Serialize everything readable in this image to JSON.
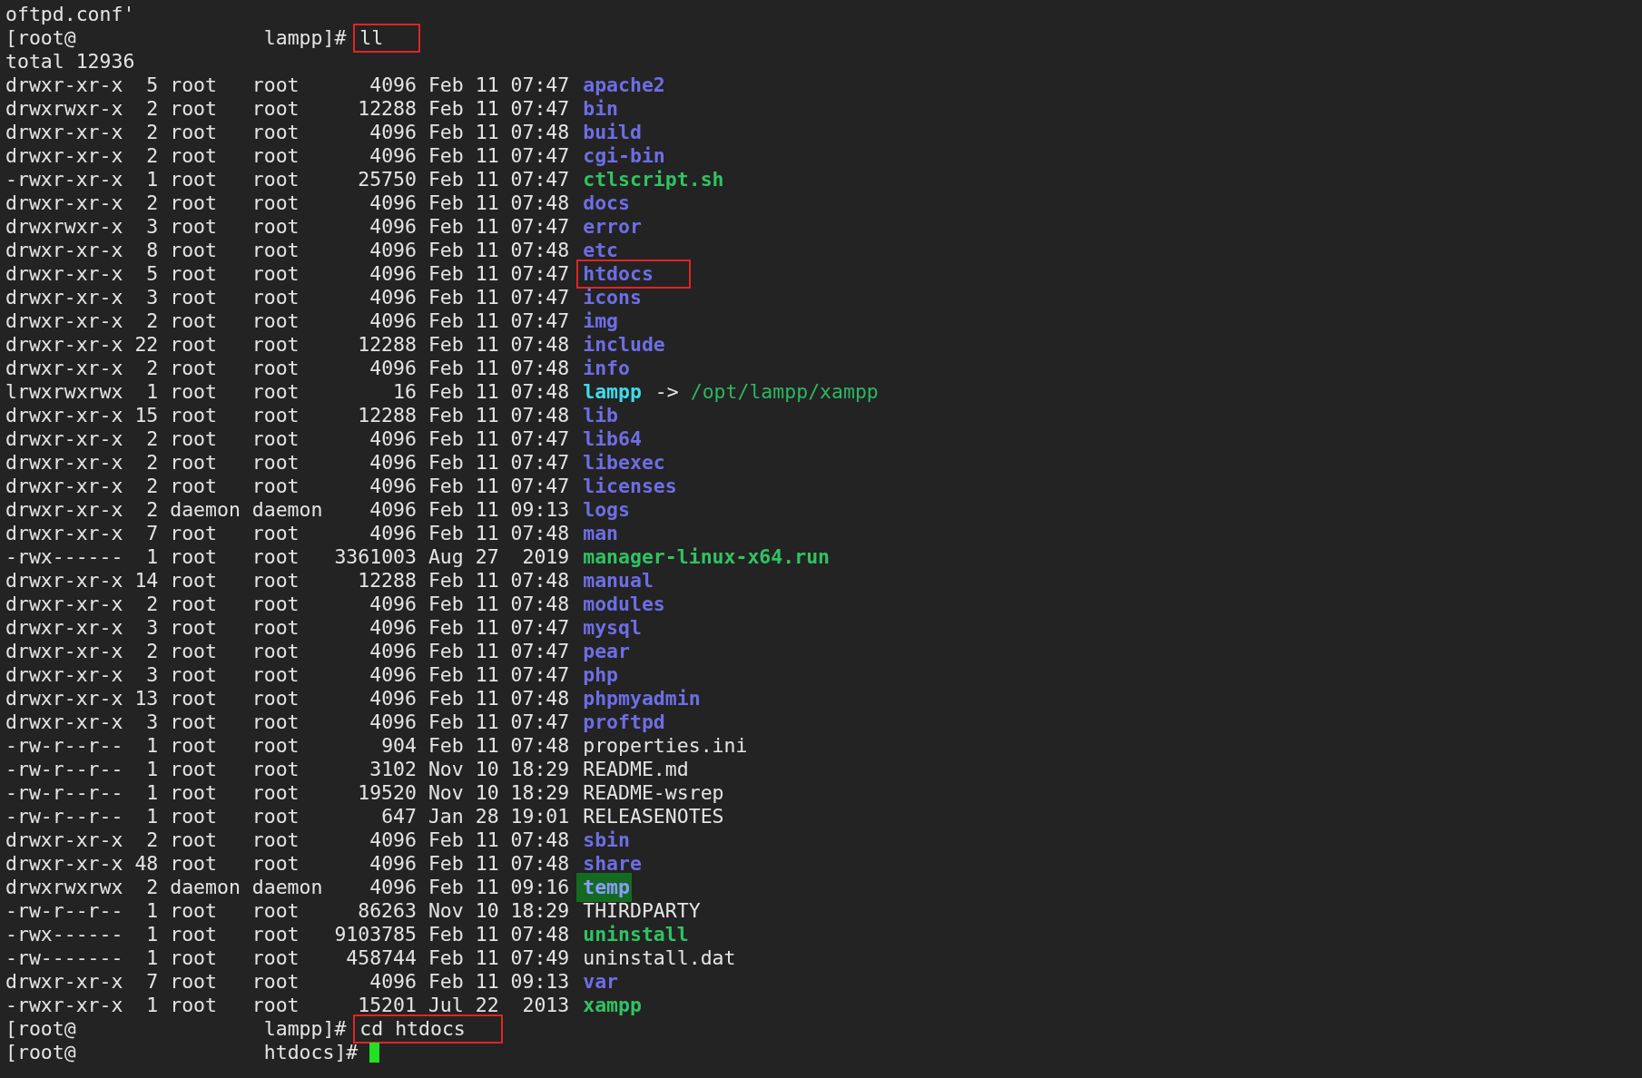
{
  "lines": [
    {
      "kind": "text",
      "text": "oftpd.conf'"
    },
    {
      "kind": "prompt",
      "user": "[root@",
      "dir": "lampp]#",
      "command": "ll",
      "boxed": true,
      "cursor": false
    },
    {
      "kind": "text",
      "text": "total 12936"
    },
    {
      "kind": "dir",
      "mode": "drwxr-xr-x",
      "links": "5",
      "owner": "root",
      "group": "root",
      "bytes": "4096",
      "date": "Feb 11 07:47",
      "name": "apache2",
      "boxed": false
    },
    {
      "kind": "dir",
      "mode": "drwxrwxr-x",
      "links": "2",
      "owner": "root",
      "group": "root",
      "bytes": "12288",
      "date": "Feb 11 07:47",
      "name": "bin",
      "boxed": false
    },
    {
      "kind": "dir",
      "mode": "drwxr-xr-x",
      "links": "2",
      "owner": "root",
      "group": "root",
      "bytes": "4096",
      "date": "Feb 11 07:48",
      "name": "build",
      "boxed": false
    },
    {
      "kind": "dir",
      "mode": "drwxr-xr-x",
      "links": "2",
      "owner": "root",
      "group": "root",
      "bytes": "4096",
      "date": "Feb 11 07:47",
      "name": "cgi-bin",
      "boxed": false
    },
    {
      "kind": "exec",
      "mode": "-rwxr-xr-x",
      "links": "1",
      "owner": "root",
      "group": "root",
      "bytes": "25750",
      "date": "Feb 11 07:47",
      "name": "ctlscript.sh",
      "boxed": false
    },
    {
      "kind": "dir",
      "mode": "drwxr-xr-x",
      "links": "2",
      "owner": "root",
      "group": "root",
      "bytes": "4096",
      "date": "Feb 11 07:48",
      "name": "docs",
      "boxed": false
    },
    {
      "kind": "dir",
      "mode": "drwxrwxr-x",
      "links": "3",
      "owner": "root",
      "group": "root",
      "bytes": "4096",
      "date": "Feb 11 07:47",
      "name": "error",
      "boxed": false
    },
    {
      "kind": "dir",
      "mode": "drwxr-xr-x",
      "links": "8",
      "owner": "root",
      "group": "root",
      "bytes": "4096",
      "date": "Feb 11 07:48",
      "name": "etc",
      "boxed": false
    },
    {
      "kind": "dir",
      "mode": "drwxr-xr-x",
      "links": "5",
      "owner": "root",
      "group": "root",
      "bytes": "4096",
      "date": "Feb 11 07:47",
      "name": "htdocs",
      "boxed": true
    },
    {
      "kind": "dir",
      "mode": "drwxr-xr-x",
      "links": "3",
      "owner": "root",
      "group": "root",
      "bytes": "4096",
      "date": "Feb 11 07:47",
      "name": "icons",
      "boxed": false
    },
    {
      "kind": "dir",
      "mode": "drwxr-xr-x",
      "links": "2",
      "owner": "root",
      "group": "root",
      "bytes": "4096",
      "date": "Feb 11 07:47",
      "name": "img",
      "boxed": false
    },
    {
      "kind": "dir",
      "mode": "drwxr-xr-x",
      "links": "22",
      "owner": "root",
      "group": "root",
      "bytes": "12288",
      "date": "Feb 11 07:48",
      "name": "include",
      "boxed": false
    },
    {
      "kind": "dir",
      "mode": "drwxr-xr-x",
      "links": "2",
      "owner": "root",
      "group": "root",
      "bytes": "4096",
      "date": "Feb 11 07:48",
      "name": "info",
      "boxed": false
    },
    {
      "kind": "link",
      "mode": "lrwxrwxrwx",
      "links": "1",
      "owner": "root",
      "group": "root",
      "bytes": "16",
      "date": "Feb 11 07:48",
      "name": "lampp",
      "arrow": "->",
      "target": "/opt/lampp/xampp",
      "boxed": false
    },
    {
      "kind": "dir",
      "mode": "drwxr-xr-x",
      "links": "15",
      "owner": "root",
      "group": "root",
      "bytes": "12288",
      "date": "Feb 11 07:48",
      "name": "lib",
      "boxed": false
    },
    {
      "kind": "dir",
      "mode": "drwxr-xr-x",
      "links": "2",
      "owner": "root",
      "group": "root",
      "bytes": "4096",
      "date": "Feb 11 07:47",
      "name": "lib64",
      "boxed": false
    },
    {
      "kind": "dir",
      "mode": "drwxr-xr-x",
      "links": "2",
      "owner": "root",
      "group": "root",
      "bytes": "4096",
      "date": "Feb 11 07:47",
      "name": "libexec",
      "boxed": false
    },
    {
      "kind": "dir",
      "mode": "drwxr-xr-x",
      "links": "2",
      "owner": "root",
      "group": "root",
      "bytes": "4096",
      "date": "Feb 11 07:47",
      "name": "licenses",
      "boxed": false
    },
    {
      "kind": "dir",
      "mode": "drwxr-xr-x",
      "links": "2",
      "owner": "daemon",
      "group": "daemon",
      "bytes": "4096",
      "date": "Feb 11 09:13",
      "name": "logs",
      "boxed": false
    },
    {
      "kind": "dir",
      "mode": "drwxr-xr-x",
      "links": "7",
      "owner": "root",
      "group": "root",
      "bytes": "4096",
      "date": "Feb 11 07:48",
      "name": "man",
      "boxed": false
    },
    {
      "kind": "exec",
      "mode": "-rwx------",
      "links": "1",
      "owner": "root",
      "group": "root",
      "bytes": "3361003",
      "date": "Aug 27  2019",
      "name": "manager-linux-x64.run",
      "boxed": false
    },
    {
      "kind": "dir",
      "mode": "drwxr-xr-x",
      "links": "14",
      "owner": "root",
      "group": "root",
      "bytes": "12288",
      "date": "Feb 11 07:48",
      "name": "manual",
      "boxed": false
    },
    {
      "kind": "dir",
      "mode": "drwxr-xr-x",
      "links": "2",
      "owner": "root",
      "group": "root",
      "bytes": "4096",
      "date": "Feb 11 07:48",
      "name": "modules",
      "boxed": false
    },
    {
      "kind": "dir",
      "mode": "drwxr-xr-x",
      "links": "3",
      "owner": "root",
      "group": "root",
      "bytes": "4096",
      "date": "Feb 11 07:47",
      "name": "mysql",
      "boxed": false
    },
    {
      "kind": "dir",
      "mode": "drwxr-xr-x",
      "links": "2",
      "owner": "root",
      "group": "root",
      "bytes": "4096",
      "date": "Feb 11 07:47",
      "name": "pear",
      "boxed": false
    },
    {
      "kind": "dir",
      "mode": "drwxr-xr-x",
      "links": "3",
      "owner": "root",
      "group": "root",
      "bytes": "4096",
      "date": "Feb 11 07:47",
      "name": "php",
      "boxed": false
    },
    {
      "kind": "dir",
      "mode": "drwxr-xr-x",
      "links": "13",
      "owner": "root",
      "group": "root",
      "bytes": "4096",
      "date": "Feb 11 07:48",
      "name": "phpmyadmin",
      "boxed": false
    },
    {
      "kind": "dir",
      "mode": "drwxr-xr-x",
      "links": "3",
      "owner": "root",
      "group": "root",
      "bytes": "4096",
      "date": "Feb 11 07:47",
      "name": "proftpd",
      "boxed": false
    },
    {
      "kind": "file",
      "mode": "-rw-r--r--",
      "links": "1",
      "owner": "root",
      "group": "root",
      "bytes": "904",
      "date": "Feb 11 07:48",
      "name": "properties.ini",
      "boxed": false
    },
    {
      "kind": "file",
      "mode": "-rw-r--r--",
      "links": "1",
      "owner": "root",
      "group": "root",
      "bytes": "3102",
      "date": "Nov 10 18:29",
      "name": "README.md",
      "boxed": false
    },
    {
      "kind": "file",
      "mode": "-rw-r--r--",
      "links": "1",
      "owner": "root",
      "group": "root",
      "bytes": "19520",
      "date": "Nov 10 18:29",
      "name": "README-wsrep",
      "boxed": false
    },
    {
      "kind": "file",
      "mode": "-rw-r--r--",
      "links": "1",
      "owner": "root",
      "group": "root",
      "bytes": "647",
      "date": "Jan 28 19:01",
      "name": "RELEASENOTES",
      "boxed": false
    },
    {
      "kind": "dir",
      "mode": "drwxr-xr-x",
      "links": "2",
      "owner": "root",
      "group": "root",
      "bytes": "4096",
      "date": "Feb 11 07:48",
      "name": "sbin",
      "boxed": false
    },
    {
      "kind": "dir",
      "mode": "drwxr-xr-x",
      "links": "48",
      "owner": "root",
      "group": "root",
      "bytes": "4096",
      "date": "Feb 11 07:48",
      "name": "share",
      "boxed": false
    },
    {
      "kind": "sticky",
      "mode": "drwxrwxrwx",
      "links": "2",
      "owner": "daemon",
      "group": "daemon",
      "bytes": "4096",
      "date": "Feb 11 09:16",
      "name": "temp",
      "boxed": false
    },
    {
      "kind": "file",
      "mode": "-rw-r--r--",
      "links": "1",
      "owner": "root",
      "group": "root",
      "bytes": "86263",
      "date": "Nov 10 18:29",
      "name": "THIRDPARTY",
      "boxed": false
    },
    {
      "kind": "exec",
      "mode": "-rwx------",
      "links": "1",
      "owner": "root",
      "group": "root",
      "bytes": "9103785",
      "date": "Feb 11 07:48",
      "name": "uninstall",
      "boxed": false
    },
    {
      "kind": "file",
      "mode": "-rw-------",
      "links": "1",
      "owner": "root",
      "group": "root",
      "bytes": "458744",
      "date": "Feb 11 07:49",
      "name": "uninstall.dat",
      "boxed": false
    },
    {
      "kind": "dir",
      "mode": "drwxr-xr-x",
      "links": "7",
      "owner": "root",
      "group": "root",
      "bytes": "4096",
      "date": "Feb 11 09:13",
      "name": "var",
      "boxed": false
    },
    {
      "kind": "exec",
      "mode": "-rwxr-xr-x",
      "links": "1",
      "owner": "root",
      "group": "root",
      "bytes": "15201",
      "date": "Jul 22  2013",
      "name": "xampp",
      "boxed": false
    },
    {
      "kind": "prompt",
      "user": "[root@",
      "dir": "lampp]#",
      "command": "cd htdocs",
      "boxed": true,
      "cursor": false
    },
    {
      "kind": "prompt",
      "user": "[root@",
      "dir": "htdocs]#",
      "cursor": true
    }
  ]
}
